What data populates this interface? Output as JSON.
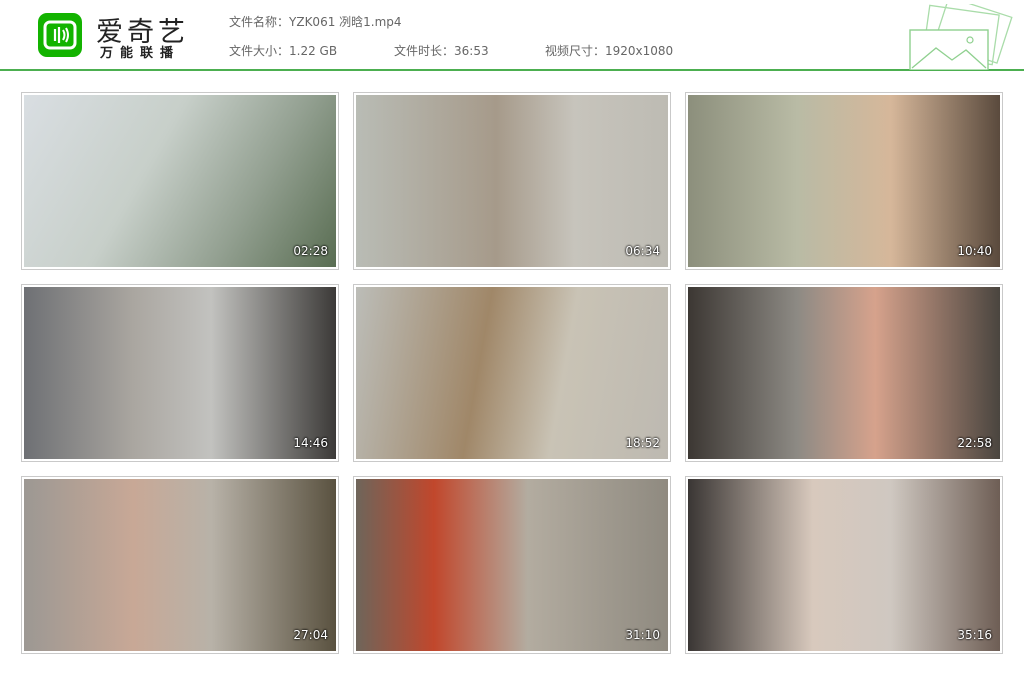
{
  "brand": {
    "name": "爱奇艺",
    "sub": "万能联播",
    "color": "#13b300"
  },
  "file": {
    "name_label": "文件名称：",
    "name_value": "YZK061 冽晗1.mp4",
    "size_label": "文件大小：",
    "size_value": "1.22 GB",
    "duration_label": "文件时长：",
    "duration_value": "36:53",
    "resolution_label": "视频尺寸：",
    "resolution_value": "1920x1080"
  },
  "accent": "#4caf50",
  "thumbnails": [
    {
      "time": "02:28"
    },
    {
      "time": "06:34"
    },
    {
      "time": "10:40"
    },
    {
      "time": "14:46"
    },
    {
      "time": "18:52"
    },
    {
      "time": "22:58"
    },
    {
      "time": "27:04"
    },
    {
      "time": "31:10"
    },
    {
      "time": "35:16"
    }
  ]
}
